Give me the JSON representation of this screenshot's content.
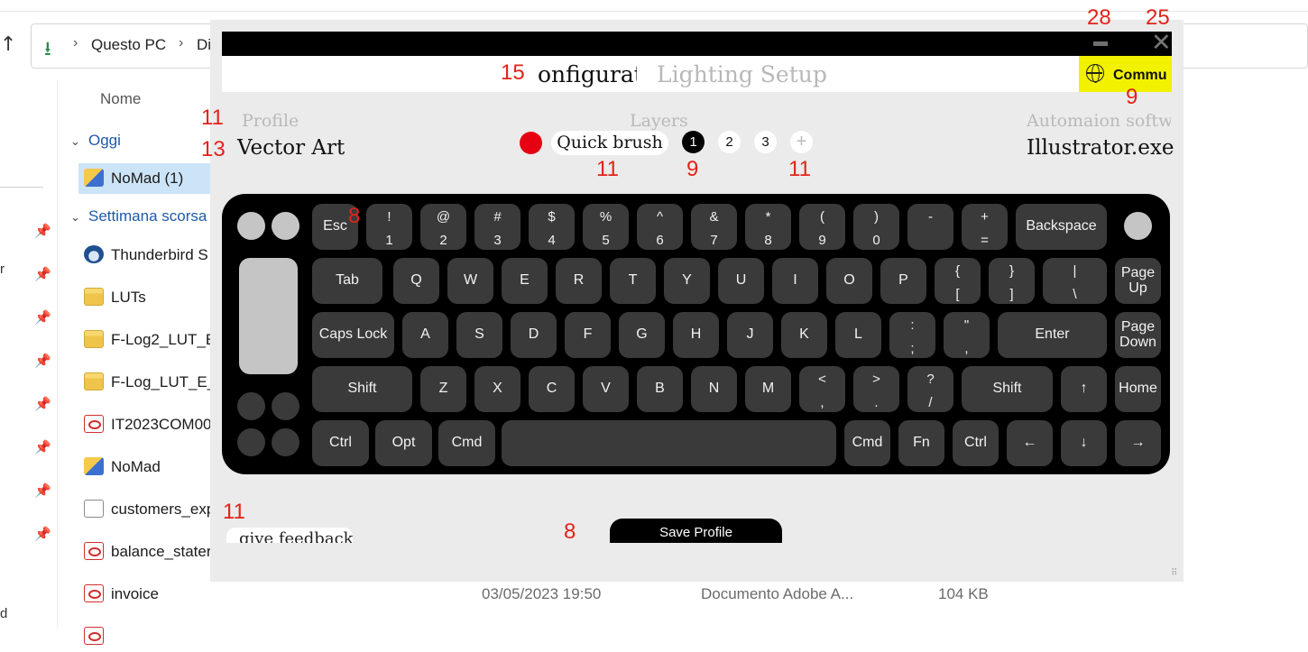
{
  "explorer": {
    "breadcrumb": [
      "Questo PC",
      "Di"
    ],
    "column_header": "Nome",
    "groups": [
      {
        "label": "Oggi"
      },
      {
        "label": "Settimana scorsa"
      }
    ],
    "files": [
      {
        "name": "NoMad (1)",
        "icon": "folder-zip-icon"
      },
      {
        "name": "Thunderbird S",
        "icon": "thunderbird-icon"
      },
      {
        "name": "LUTs",
        "icon": "folder-icon"
      },
      {
        "name": "F-Log2_LUT_E_",
        "icon": "folder-icon"
      },
      {
        "name": "F-Log_LUT_E_V",
        "icon": "folder-icon"
      },
      {
        "name": "IT2023COM00",
        "icon": "pdf-icon"
      },
      {
        "name": "NoMad",
        "icon": "folder-zip-icon"
      },
      {
        "name": "customers_exp",
        "icon": "document-icon"
      },
      {
        "name": "balance_stater",
        "icon": "pdf-icon"
      },
      {
        "name": "invoice",
        "icon": "pdf-icon"
      }
    ],
    "invoice_meta": {
      "date": "03/05/2023 19:50",
      "type": "Documento Adobe A...",
      "size": "104 KB"
    },
    "left_edge_letters": [
      "r",
      "d"
    ]
  },
  "app": {
    "tabs": {
      "configurator": "onfigurat",
      "lighting": "Lighting Setup"
    },
    "community_label": "Commu",
    "profile": {
      "label": "Profile",
      "value": "Vector Art"
    },
    "layers": {
      "label": "Layers",
      "current_name": "Quick brush",
      "numbers": [
        "1",
        "2",
        "3"
      ],
      "add": "+",
      "active": "1",
      "color": "#e60012"
    },
    "automation": {
      "label": "Automaion softw",
      "value": "Illustrator.exe"
    },
    "feedback_label": "give feedback",
    "save_label": "Save Profile",
    "keys": {
      "esc": "Esc",
      "num": [
        [
          "!",
          "1"
        ],
        [
          "@",
          "2"
        ],
        [
          "#",
          "3"
        ],
        [
          "$",
          "4"
        ],
        [
          "%",
          "5"
        ],
        [
          "^",
          "6"
        ],
        [
          "&",
          "7"
        ],
        [
          "*",
          "8"
        ],
        [
          "(",
          "9"
        ],
        [
          ")",
          "0"
        ],
        [
          "-",
          ""
        ],
        [
          "+",
          "="
        ]
      ],
      "backspace": "Backspace",
      "tab": "Tab",
      "row2": [
        "Q",
        "W",
        "E",
        "R",
        "T",
        "Y",
        "U",
        "I",
        "O",
        "P"
      ],
      "bracket_l": [
        "{",
        "["
      ],
      "bracket_r": [
        "}",
        "]"
      ],
      "pipe": [
        "|",
        "\\"
      ],
      "pageup": "Page Up",
      "caps": "Caps Lock",
      "row3": [
        "A",
        "S",
        "D",
        "F",
        "G",
        "H",
        "J",
        "K",
        "L"
      ],
      "colon": [
        ":",
        ";"
      ],
      "quote": [
        "\"",
        ","
      ],
      "enter": "Enter",
      "pagedown": "Page Down",
      "shift": "Shift",
      "row4": [
        "Z",
        "X",
        "C",
        "V",
        "B",
        "N",
        "M"
      ],
      "lt": [
        "<",
        ","
      ],
      "gt": [
        ">",
        "."
      ],
      "q": [
        "?",
        "/"
      ],
      "up": "↑",
      "home": "Home",
      "ctrl": "Ctrl",
      "opt": "Opt",
      "cmd": "Cmd",
      "fn": "Fn",
      "left": "←",
      "down": "↓",
      "right": "→"
    }
  },
  "annotations": {
    "a28": "28",
    "a25": "25",
    "a15": "15",
    "a9_comm": "9",
    "a11_profile": "11",
    "a13": "13",
    "a11_layer": "11",
    "a9_layer": "9",
    "a11_add": "11",
    "a8_esc": "8",
    "a11_feedback": "11",
    "a8_save": "8"
  },
  "colors": {
    "accent_yellow": "#f2f200",
    "layer_red": "#e60012",
    "annotation_red": "#e2231a"
  }
}
